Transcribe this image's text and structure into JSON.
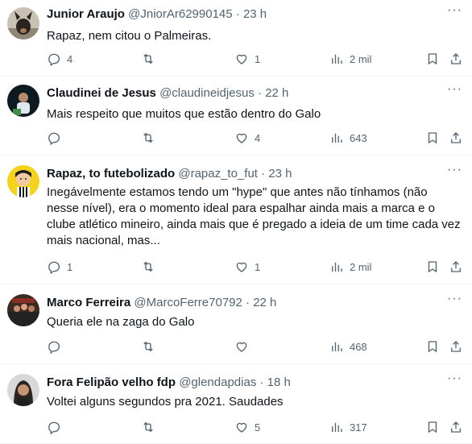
{
  "tweets": [
    {
      "name": "Junior Araujo",
      "handle": "@JniorAr62990145",
      "time": "23 h",
      "text": "Rapaz, nem citou o Palmeiras.",
      "replies": "4",
      "retweets": "",
      "likes": "1",
      "views": "2 mil",
      "avatar": "dog-avatar"
    },
    {
      "name": "Claudinei de Jesus",
      "handle": "@claudineidjesus",
      "time": "22 h",
      "text": "Mais respeito que muitos que estão dentro do Galo",
      "replies": "",
      "retweets": "",
      "likes": "4",
      "views": "643",
      "avatar": "person-avatar"
    },
    {
      "name": "Rapaz, to futebolizado",
      "handle": "@rapaz_to_fut",
      "time": "23 h",
      "text": "Inegávelmente estamos tendo um \"hype\" que antes não tínhamos (não nesse nível), era o momento ideal para espalhar ainda mais a marca e o clube atlético mineiro, ainda mais que é pregado a ideia de um time cada vez mais nacional, mas...",
      "replies": "1",
      "retweets": "",
      "likes": "1",
      "views": "2 mil",
      "avatar": "cartoon-avatar"
    },
    {
      "name": "Marco Ferreira",
      "handle": "@MarcoFerre70792",
      "time": "22 h",
      "text": "Queria ele na zaga do Galo",
      "replies": "",
      "retweets": "",
      "likes": "",
      "views": "468",
      "avatar": "group-avatar"
    },
    {
      "name": "Fora Felipão velho fdp",
      "handle": "@glendapdias",
      "time": "18 h",
      "text": "Voltei alguns segundos pra 2021. Saudades",
      "replies": "",
      "retweets": "",
      "likes": "5",
      "views": "317",
      "avatar": "woman-avatar"
    }
  ],
  "separator": "·",
  "more_icon": "···",
  "colors": {
    "text": "#0f1419",
    "secondary": "#536471",
    "border": "#eff3f4"
  }
}
